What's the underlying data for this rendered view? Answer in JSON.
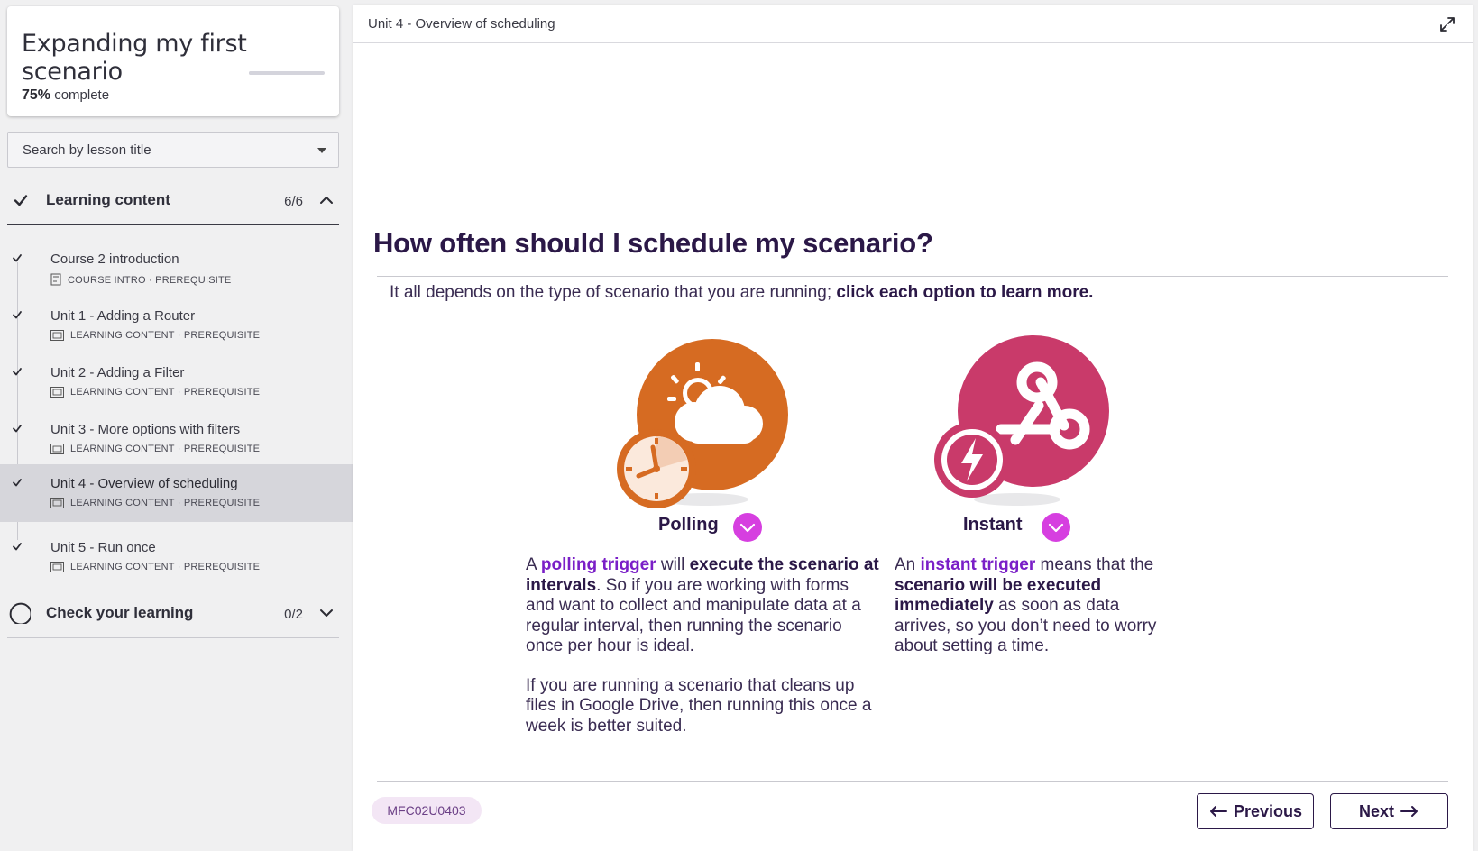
{
  "sidebar": {
    "course_title": "Expanding my first scenario",
    "progress_percent": 75,
    "progress_value": "75%",
    "progress_suffix": "complete",
    "search_placeholder": "Search by lesson title",
    "sections": [
      {
        "title": "Learning content",
        "count": "6/6",
        "expanded": true,
        "complete": true
      },
      {
        "title": "Check your learning",
        "count": "0/2",
        "expanded": false,
        "complete": false
      }
    ],
    "lessons": [
      {
        "name": "Course 2 introduction",
        "type": "COURSE INTRO",
        "tag": "PREREQUISITE",
        "icon": "document-icon"
      },
      {
        "name": "Unit 1 - Adding a Router",
        "type": "LEARNING CONTENT",
        "tag": "PREREQUISITE",
        "icon": "slides-icon"
      },
      {
        "name": "Unit 2 - Adding a Filter",
        "type": "LEARNING CONTENT",
        "tag": "PREREQUISITE",
        "icon": "slides-icon"
      },
      {
        "name": "Unit 3 - More options with filters",
        "type": "LEARNING CONTENT",
        "tag": "PREREQUISITE",
        "icon": "slides-icon"
      },
      {
        "name": "Unit 4 - Overview of scheduling",
        "type": "LEARNING CONTENT",
        "tag": "PREREQUISITE",
        "icon": "slides-icon",
        "active": true
      },
      {
        "name": "Unit 5 - Run once",
        "type": "LEARNING CONTENT",
        "tag": "PREREQUISITE",
        "icon": "slides-icon"
      }
    ],
    "meta_separator": "·"
  },
  "main": {
    "breadcrumb": "Unit 4 - Overview of scheduling",
    "heading": "How often should I schedule my scenario?",
    "intro_plain": "It all depends on the type of scenario that you are running; ",
    "intro_bold": "click each option to learn more.",
    "options": [
      {
        "label": "Polling",
        "icon": "polling-clock-cloud-icon",
        "color": "#d66b22",
        "p1": [
          "A ",
          "polling trigger",
          " will ",
          "execute the scenario at intervals",
          ". So if you are working with forms and want to collect and manipulate data at a regular interval, then running the scenario once per hour is ideal."
        ],
        "p2": "If you are running a scenario that cleans up files in Google Drive, then running this once a week is better suited."
      },
      {
        "label": "Instant",
        "icon": "instant-webhook-lightning-icon",
        "color": "#c93a6a",
        "p1": [
          "An ",
          "instant trigger",
          " means that the ",
          "scenario will be executed immediately",
          " as soon as data arrives, so you don’t need to worry about setting a time."
        ]
      }
    ],
    "code": "MFC02U0403",
    "prev_label": "Previous",
    "next_label": "Next"
  },
  "colors": {
    "accent_purple": "#7a1fc7",
    "chevron_magenta": "#d63fe0",
    "heading_navy": "#2b1847"
  }
}
